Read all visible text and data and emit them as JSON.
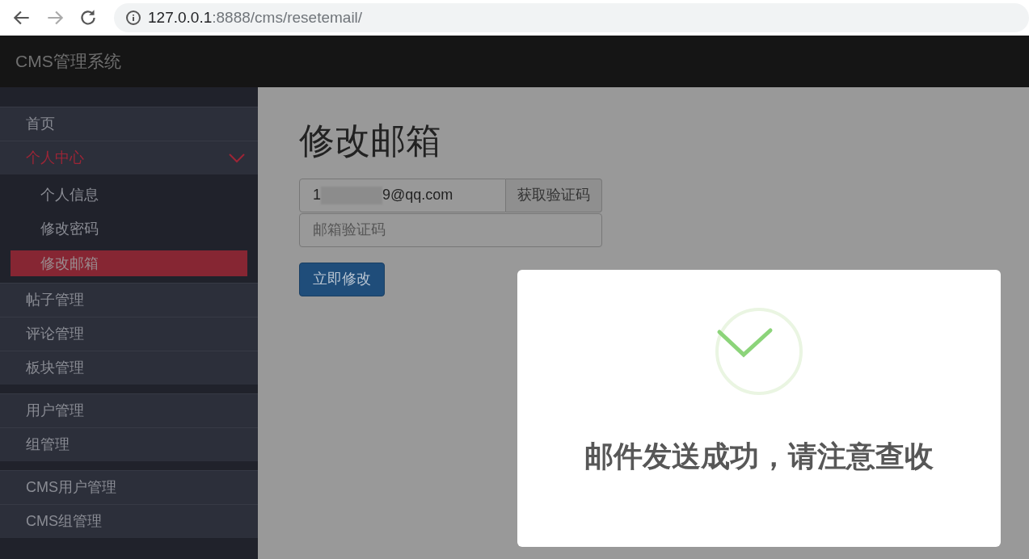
{
  "browser": {
    "url_host": "127.0.0.1",
    "url_path": ":8888/cms/resetemail/"
  },
  "navbar": {
    "brand": "CMS管理系统"
  },
  "sidebar": {
    "groups": [
      [
        {
          "label": "首页",
          "selected": false,
          "expanded": false
        },
        {
          "label": "个人中心",
          "selected": false,
          "expanded": true,
          "children": [
            {
              "label": "个人信息",
              "selected": false
            },
            {
              "label": "修改密码",
              "selected": false
            },
            {
              "label": "修改邮箱",
              "selected": true
            }
          ]
        },
        {
          "label": "帖子管理",
          "selected": false,
          "expanded": false
        },
        {
          "label": "评论管理",
          "selected": false,
          "expanded": false
        },
        {
          "label": "板块管理",
          "selected": false,
          "expanded": false
        }
      ],
      [
        {
          "label": "用户管理",
          "selected": false,
          "expanded": false
        },
        {
          "label": "组管理",
          "selected": false,
          "expanded": false
        }
      ],
      [
        {
          "label": "CMS用户管理",
          "selected": false,
          "expanded": false
        },
        {
          "label": "CMS组管理",
          "selected": false,
          "expanded": false
        }
      ]
    ]
  },
  "page": {
    "title": "修改邮箱",
    "email": {
      "prefix": "1",
      "suffix": "9@qq.com",
      "redacted": true
    },
    "get_code_button": "获取验证码",
    "code_field": {
      "placeholder": "邮箱验证码"
    },
    "submit_button": "立即修改"
  },
  "alert": {
    "kind": "success",
    "message": "邮件发送成功，请注意查收"
  }
}
